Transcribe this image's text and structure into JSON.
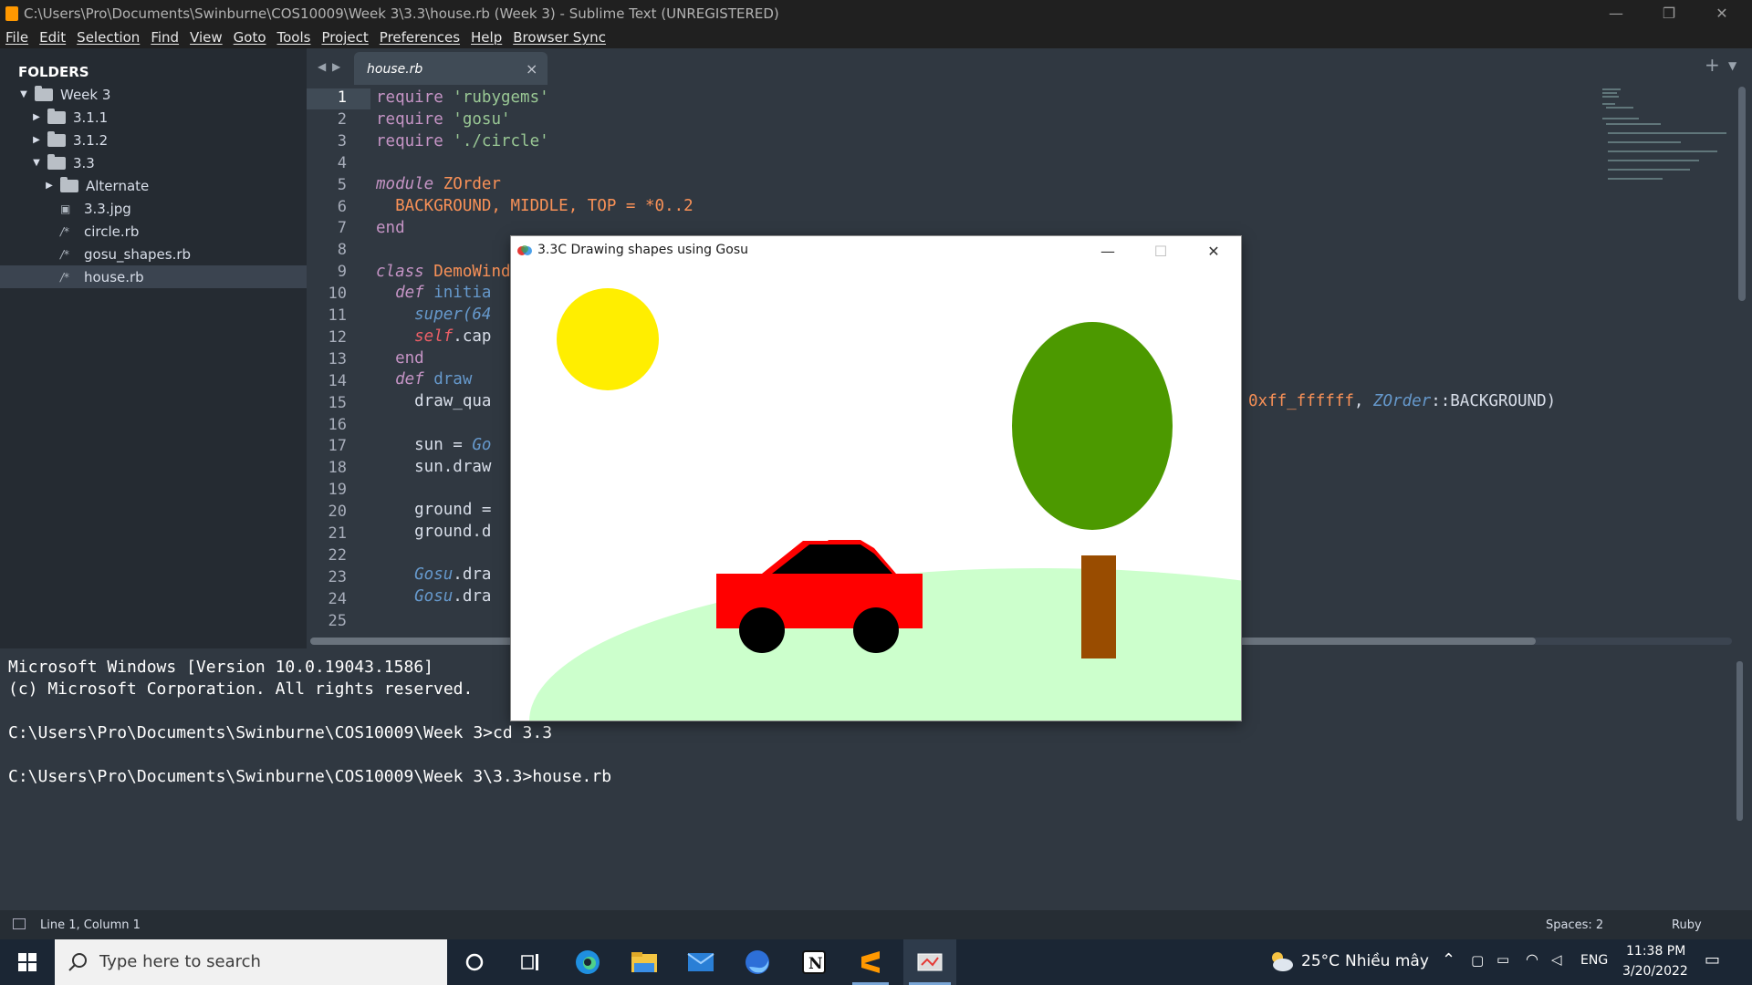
{
  "window": {
    "title": "C:\\Users\\Pro\\Documents\\Swinburne\\COS10009\\Week 3\\3.3\\house.rb (Week 3) - Sublime Text (UNREGISTERED)",
    "controls": {
      "minimize": "—",
      "restore": "❐",
      "close": "✕"
    }
  },
  "menu": [
    "File",
    "Edit",
    "Selection",
    "Find",
    "View",
    "Goto",
    "Tools",
    "Project",
    "Preferences",
    "Help",
    "Browser Sync"
  ],
  "sidebar": {
    "header": "FOLDERS",
    "items": [
      {
        "label": "Week 3",
        "type": "folder",
        "expanded": true
      },
      {
        "label": "3.1.1",
        "type": "folder",
        "expanded": false
      },
      {
        "label": "3.1.2",
        "type": "folder",
        "expanded": false
      },
      {
        "label": "3.3",
        "type": "folder",
        "expanded": true
      },
      {
        "label": "Alternate",
        "type": "folder",
        "expanded": false
      },
      {
        "label": "3.3.jpg",
        "type": "image"
      },
      {
        "label": "circle.rb",
        "type": "file"
      },
      {
        "label": "gosu_shapes.rb",
        "type": "file"
      },
      {
        "label": "house.rb",
        "type": "file",
        "selected": true
      }
    ]
  },
  "tabs": [
    {
      "label": "house.rb",
      "close": "×"
    }
  ],
  "tab_controls": {
    "add": "+",
    "menu": "▼"
  },
  "editor": {
    "line_numbers": [
      "1",
      "2",
      "3",
      "4",
      "5",
      "6",
      "7",
      "8",
      "9",
      "10",
      "11",
      "12",
      "13",
      "14",
      "15",
      "16",
      "17",
      "18",
      "19",
      "20",
      "21",
      "22",
      "23",
      "24",
      "25"
    ],
    "lines": {
      "l1_kw": "require",
      "l1_str": " 'rubygems'",
      "l2_kw": "require",
      "l2_str": " 'gosu'",
      "l3_kw": "require",
      "l3_str": " './circle'",
      "l5_kw": "module",
      "l5_name": " ZOrder",
      "l6": "  BACKGROUND, MIDDLE, TOP = *0..2",
      "l7_kw": "end",
      "l9_kw": "class",
      "l9_name": " DemoWind",
      "l10_kw": "  def",
      "l10_name": " initia",
      "l11": "    super(64",
      "l12_self": "    self",
      "l12_rest": ".cap",
      "l13_kw": "  end",
      "l14_kw": "  def",
      "l14_name": " draw",
      "l15": "    draw_qua",
      "l15_tail_hex": "0xff_ffffff",
      "l15_tail_sep": ", ",
      "l15_tail_const": "ZOrder",
      "l15_tail_rest": "::BACKGROUND)",
      "l17": "    sun = ",
      "l17_cls": "Go",
      "l18": "    sun.draw",
      "l20": "    ground =",
      "l21": "    ground.d",
      "l23": "    Gosu",
      "l23_rest": ".dra",
      "l24": "    Gosu",
      "l24_rest": ".dra"
    }
  },
  "console": {
    "lines": [
      "Microsoft Windows [Version 10.0.19043.1586]",
      "(c) Microsoft Corporation. All rights reserved.",
      "",
      "C:\\Users\\Pro\\Documents\\Swinburne\\COS10009\\Week 3>cd 3.3",
      "",
      "C:\\Users\\Pro\\Documents\\Swinburne\\COS10009\\Week 3\\3.3>house.rb"
    ]
  },
  "statusbar": {
    "position": "Line 1, Column 1",
    "spaces": "Spaces: 2",
    "syntax": "Ruby"
  },
  "gosu_window": {
    "title": "3.3C Drawing shapes using Gosu",
    "controls": {
      "minimize": "—",
      "maximize": "☐",
      "close": "✕"
    },
    "colors": {
      "sun": "#ffee00",
      "tree_leaves": "#4c9900",
      "trunk": "#994c00",
      "ground": "#ccffcc",
      "car": "#ff0000",
      "car_roof": "#000000",
      "wheels": "#000000"
    }
  },
  "taskbar": {
    "search_placeholder": "Type here to search",
    "apps": [
      "cortana-icon",
      "task-view-icon",
      "edge-icon",
      "file-explorer-icon",
      "mail-icon",
      "firefox-icon",
      "notion-icon",
      "sublime-text-icon",
      "gosu-app-icon"
    ],
    "weather_temp": "25°C",
    "weather_desc": "Nhiều mây",
    "language": "ENG",
    "time": "11:38 PM",
    "date": "3/20/2022"
  }
}
